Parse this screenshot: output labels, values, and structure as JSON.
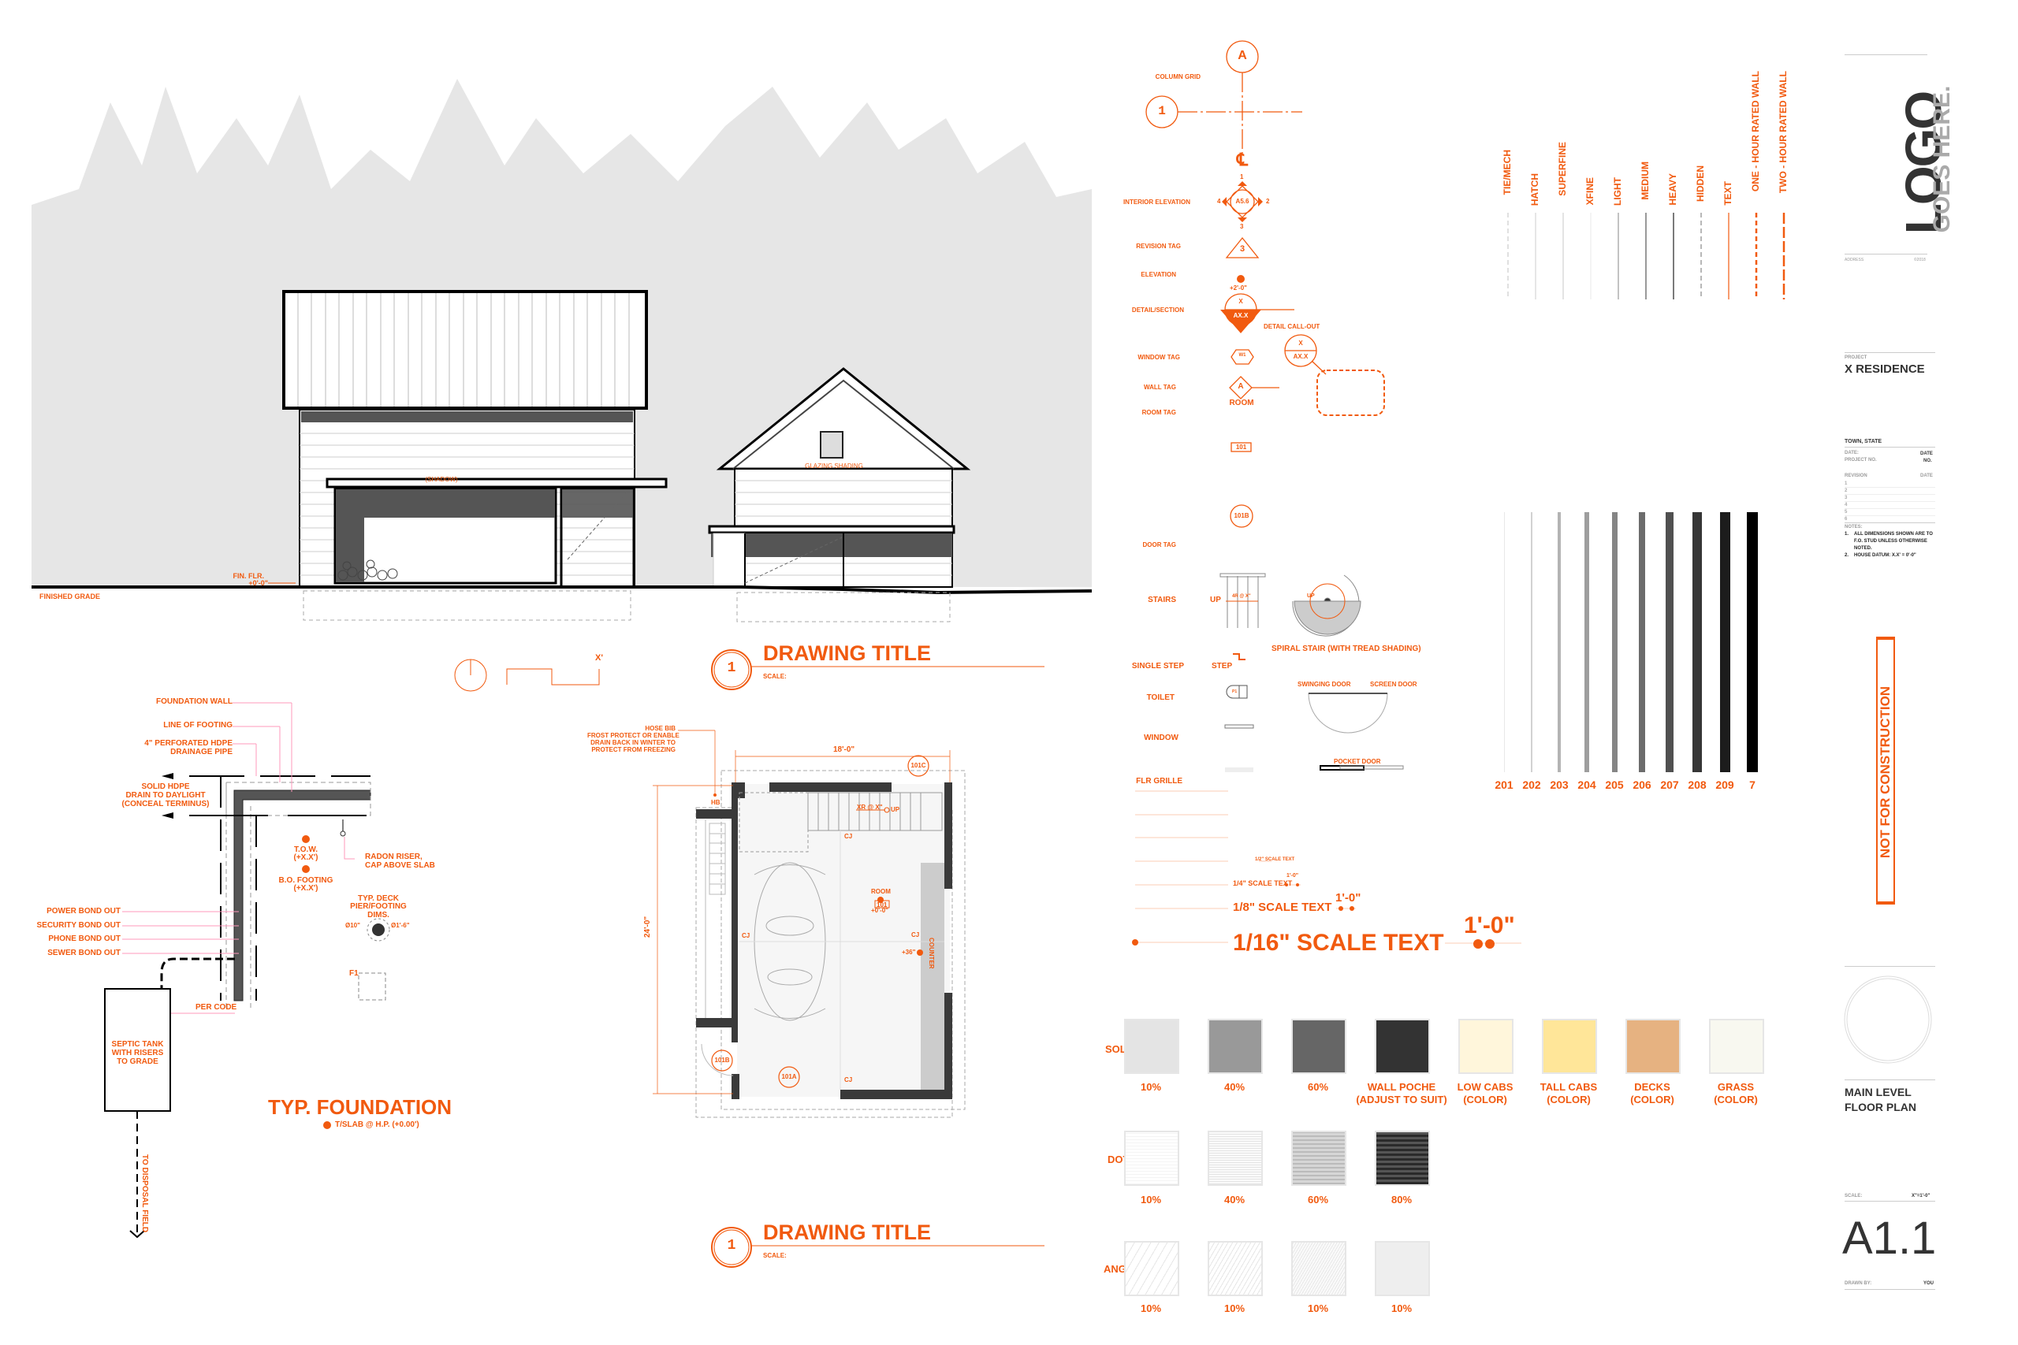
{
  "colors": {
    "accent": "#f15a0f",
    "wall": "#3a3a3a",
    "background_trees": "#e6e6e6",
    "title_dark": "#333333",
    "title_gray": "#9a9a9a"
  },
  "elevation": {
    "labels": {
      "shadow": "(SHADOW)",
      "fin_flr": "FIN. FLR.",
      "fin_flr_value": "+0'-0\"",
      "finished_grade": "FINISHED GRADE",
      "glazing_shading": "GLAZING SHADING"
    }
  },
  "section_marker": {
    "label": "X'"
  },
  "drawing_titles": [
    {
      "number": "1",
      "title": "DRAWING TITLE",
      "scale_label": "SCALE:"
    },
    {
      "number": "1",
      "title": "DRAWING TITLE",
      "scale_label": "SCALE:"
    }
  ],
  "foundation": {
    "title": "TYP. FOUNDATION",
    "callouts": {
      "foundation_wall": "FOUNDATION WALL",
      "line_of_footing": "LINE OF FOOTING",
      "drainage_pipe_1": "4\" PERFORATED HDPE",
      "drainage_pipe_2": "DRAINAGE PIPE",
      "solid_hdpe_1": "SOLID HDPE",
      "solid_hdpe_2": "DRAIN TO DAYLIGHT",
      "solid_hdpe_3": "(CONCEAL TERMINUS)",
      "tow": "T.O.W.",
      "tow_value": "(+X.X')",
      "bo_footing": "B.O. FOOTING",
      "bo_footing_value": "(+X.X')",
      "radon_1": "RADON RISER,",
      "radon_2": "CAP ABOVE SLAB",
      "deck_1": "TYP. DECK",
      "deck_2": "PIER/FOOTING",
      "deck_3": "DIMS.",
      "dia_small": "Ø10\"",
      "dia_large": "Ø1'-6\"",
      "power": "POWER BOND OUT",
      "security": "SECURITY BOND OUT",
      "phone": "PHONE BOND OUT",
      "sewer": "SEWER BOND OUT",
      "f1": "F1",
      "per_code": "PER CODE",
      "septic_1": "SEPTIC TANK",
      "septic_2": "WITH RISERS",
      "septic_3": "TO GRADE",
      "tslab": "T/SLAB @ H.P. (+0.00')",
      "disposal": "TO DISPOSAL FIELD"
    }
  },
  "floor_plan": {
    "hose_bib": [
      "HOSE BIB",
      "FROST PROTECT OR ENABLE",
      "DRAIN BACK IN WINTER TO",
      "PROTECT FROM FREEZING"
    ],
    "hb": "HB",
    "width_dim": "18'-0\"",
    "height_dim": "24'-0\"",
    "door_tags": [
      "101C",
      "101B",
      "101A"
    ],
    "stair_note": "XR @ X\"",
    "up": "UP",
    "cj": "CJ",
    "room_label": "ROOM",
    "room_number": "101",
    "room_elev": "+0'-0\"",
    "counter_elev": "+36\"",
    "counter": "COUNTER"
  },
  "symbols": {
    "column_grid": {
      "label": "COLUMN GRID",
      "letter": "A",
      "number": "1",
      "centerline": "℄"
    },
    "interior_elevation": {
      "label": "INTERIOR ELEVATION",
      "sheet": "A5.6",
      "n1": "1",
      "n2": "2",
      "n3": "3",
      "n4": "4"
    },
    "revision_tag": {
      "label": "REVISION TAG",
      "value": "3"
    },
    "elevation": {
      "label": "ELEVATION",
      "value": "+2'-0\""
    },
    "detail_section": {
      "label": "DETAIL/SECTION",
      "top": "X",
      "bottom": "AX.X"
    },
    "detail_callout": {
      "label": "DETAIL CALL-OUT",
      "top": "X",
      "bottom": "AX.X"
    },
    "window_tag": {
      "label": "WINDOW TAG",
      "value": "W1"
    },
    "wall_tag": {
      "label": "WALL TAG",
      "value": "A"
    },
    "room_tag": {
      "label": "ROOM TAG",
      "room": "ROOM",
      "number": "101"
    },
    "door_tag": {
      "label": "DOOR TAG",
      "value": "101B"
    },
    "stairs": {
      "label": "STAIRS",
      "up": "UP",
      "note": "4R @ X\""
    },
    "spiral_stair": {
      "label": "SPIRAL STAIR (WITH TREAD SHADING)",
      "up": "UP"
    },
    "single_step": {
      "label": "SINGLE STEP",
      "value": "STEP"
    },
    "toilet": {
      "label": "TOILET",
      "value": "P1"
    },
    "window": {
      "label": "WINDOW"
    },
    "flr_grille": {
      "label": "FLR GRILLE"
    },
    "swinging_door": {
      "label": "SWINGING DOOR"
    },
    "screen_door": {
      "label": "SCREEN DOOR"
    },
    "pocket_door": {
      "label": "POCKET DOOR"
    }
  },
  "line_types": [
    {
      "label": "TIE/MECH",
      "color": "#cccccc",
      "dash": true
    },
    {
      "label": "HATCH",
      "color": "#d6d6d6",
      "dash": false
    },
    {
      "label": "SUPERFINE",
      "color": "#d0d0d0",
      "dash": false
    },
    {
      "label": "XFINE",
      "color": "#ececec",
      "dash": false
    },
    {
      "label": "LIGHT",
      "color": "#9a9a9a",
      "dash": false
    },
    {
      "label": "MEDIUM",
      "color": "#555555",
      "dash": false
    },
    {
      "label": "HEAVY",
      "color": "#222222",
      "dash": false
    },
    {
      "label": "HIDDEN",
      "color": "#888888",
      "dash": true
    },
    {
      "label": "TEXT",
      "color": "#f15a0f",
      "dash": false
    },
    {
      "label": "ONE - HOUR RATED WALL",
      "color": "#f15a0f",
      "dash": true
    },
    {
      "label": "TWO - HOUR RATED WALL",
      "color": "#f15a0f",
      "dash": true
    }
  ],
  "pen_weights": [
    {
      "label": "201",
      "color": "#e8e8e8"
    },
    {
      "label": "202",
      "color": "#d2d2d2"
    },
    {
      "label": "203",
      "color": "#b4b4b4"
    },
    {
      "label": "204",
      "color": "#9e9e9e"
    },
    {
      "label": "205",
      "color": "#858585"
    },
    {
      "label": "206",
      "color": "#6c6c6c"
    },
    {
      "label": "207",
      "color": "#505050"
    },
    {
      "label": "208",
      "color": "#363636"
    },
    {
      "label": "209",
      "color": "#1c1c1c"
    },
    {
      "label": "7",
      "color": "#000000"
    }
  ],
  "scale_text": {
    "quarter": "1/4\" SCALE TEXT",
    "eighth": "1/8\" SCALE TEXT",
    "sixteenth": "1/16\" SCALE TEXT",
    "half": "1/2\" SCALE TEXT",
    "dim": "1'-0\""
  },
  "hatches": {
    "rows": [
      "SOLIDS",
      "DOTS",
      "ANGLED"
    ],
    "solids": [
      {
        "label": "10%",
        "color": "#e4e4e4"
      },
      {
        "label": "40%",
        "color": "#999999"
      },
      {
        "label": "60%",
        "color": "#666666"
      },
      {
        "label": "WALL POCHE",
        "label2": "(ADJUST TO SUIT)",
        "color": "#333333"
      },
      {
        "label": "LOW CABS",
        "label2": "(COLOR)",
        "color": "#fff6db"
      },
      {
        "label": "TALL CABS",
        "label2": "(COLOR)",
        "color": "#ffe699"
      },
      {
        "label": "DECKS",
        "label2": "(COLOR)",
        "color": "#e6b281"
      },
      {
        "label": "GRASS",
        "label2": "(COLOR)",
        "color": "#f8f8f0"
      }
    ],
    "dots": [
      {
        "label": "10%"
      },
      {
        "label": "40%"
      },
      {
        "label": "60%"
      },
      {
        "label": "80%"
      }
    ],
    "angled": [
      {
        "label": "10%"
      },
      {
        "label": "10%"
      },
      {
        "label": "10%"
      },
      {
        "label": "10%"
      }
    ]
  },
  "title_block": {
    "logo": "LOGO",
    "logo_sub": "GOES HERE.",
    "address": "ADDRESS",
    "copyright": "©2018",
    "project_label": "PROJECT",
    "project_name": "X RESIDENCE",
    "location": "TOWN, STATE",
    "date_label": "DATE:",
    "date_value": "DATE",
    "project_no_label": "PROJECT NO.",
    "project_no_value": "NO.",
    "revision_label": "REVISION",
    "revision_date_label": "DATE",
    "revisions": [
      "1",
      "2",
      "3",
      "4",
      "5",
      "6"
    ],
    "notes_label": "NOTES:",
    "notes": [
      {
        "n": "1.",
        "text": "ALL DIMENSIONS SHOWN ARE TO F.O. STUD UNLESS OTHERWISE NOTED."
      },
      {
        "n": "2.",
        "text": "HOUSE DATUM: X.X' = 0'-0\""
      }
    ],
    "stamp": "NOT FOR CONSTRUCTION",
    "sheet_title_1": "MAIN LEVEL",
    "sheet_title_2": "FLOOR PLAN",
    "scale_label": "SCALE:",
    "scale_value": "X\"=1'-0\"",
    "sheet_number": "A1.1",
    "drawn_by_label": "DRAWN BY:",
    "drawn_by_value": "YOU"
  }
}
